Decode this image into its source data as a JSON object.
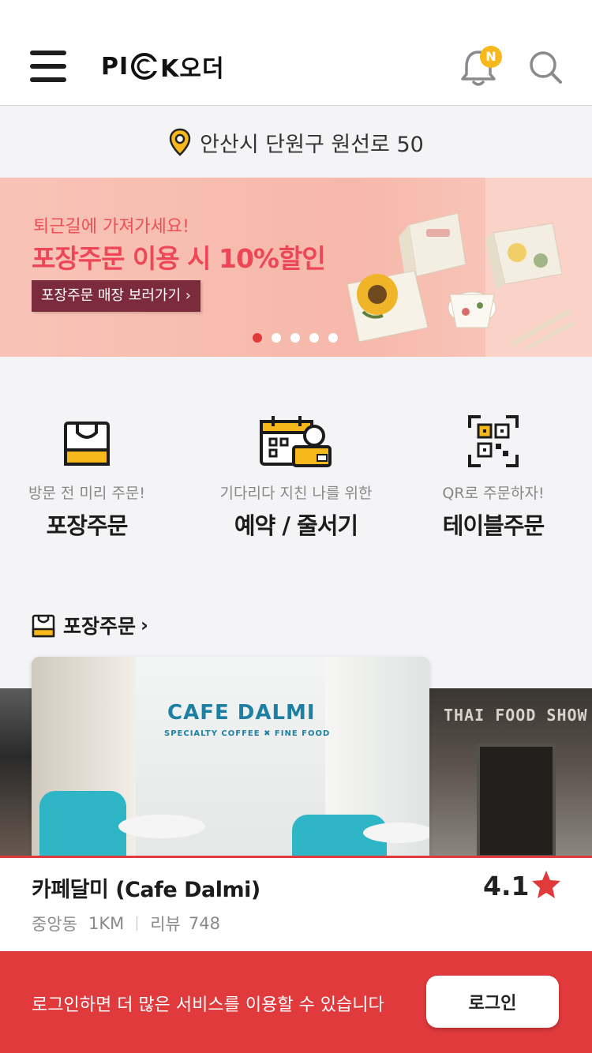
{
  "header": {
    "logo_text_left": "PI",
    "logo_text_right": "K오더",
    "notification_badge": "N",
    "icons": {
      "menu": "hamburger-menu-icon",
      "bell": "bell-icon",
      "search": "search-icon"
    }
  },
  "location": {
    "address": "안산시 단원구 원선로 50",
    "icon": "location-pin-icon"
  },
  "banner": {
    "subtitle": "퇴근길에 가져가세요!",
    "title": "포장주문 이용 시 10%할인",
    "cta": "포장주문 매장 보러가기 ›",
    "slide_count": 5,
    "active_slide": 1
  },
  "services": [
    {
      "subtitle": "방문 전 미리 주문!",
      "title": "포장주문",
      "icon": "shopping-bag-icon"
    },
    {
      "subtitle": "기다리다 지친 나를 위한",
      "title": "예약 / 줄서기",
      "icon": "calendar-reservation-icon"
    },
    {
      "subtitle": "QR로 주문하자!",
      "title": "테이블주문",
      "icon": "qr-code-icon"
    }
  ],
  "section": {
    "title": "포장주문",
    "chevron": "›"
  },
  "store_card": {
    "image_sign": "CAFE DALMI",
    "image_tagline": "SPECIALTY  COFFEE  ✖  FINE FOOD",
    "name": "카페달미 (Cafe Dalmi)",
    "rating": "4.1",
    "location": "중앙동",
    "distance": "1KM",
    "review_label": "리뷰",
    "review_count": "748"
  },
  "side_card_right": {
    "sign": "THAI FOOD SHOW"
  },
  "login_bar": {
    "message": "로그인하면 더 많은 서비스를 이용할 수 있습니다",
    "button": "로그인"
  },
  "colors": {
    "accent_red": "#e13a3d",
    "accent_yellow": "#f6b81a",
    "banner_pink": "#f6b8aa",
    "banner_text": "#ee4657",
    "banner_button": "#7c2b3c"
  }
}
